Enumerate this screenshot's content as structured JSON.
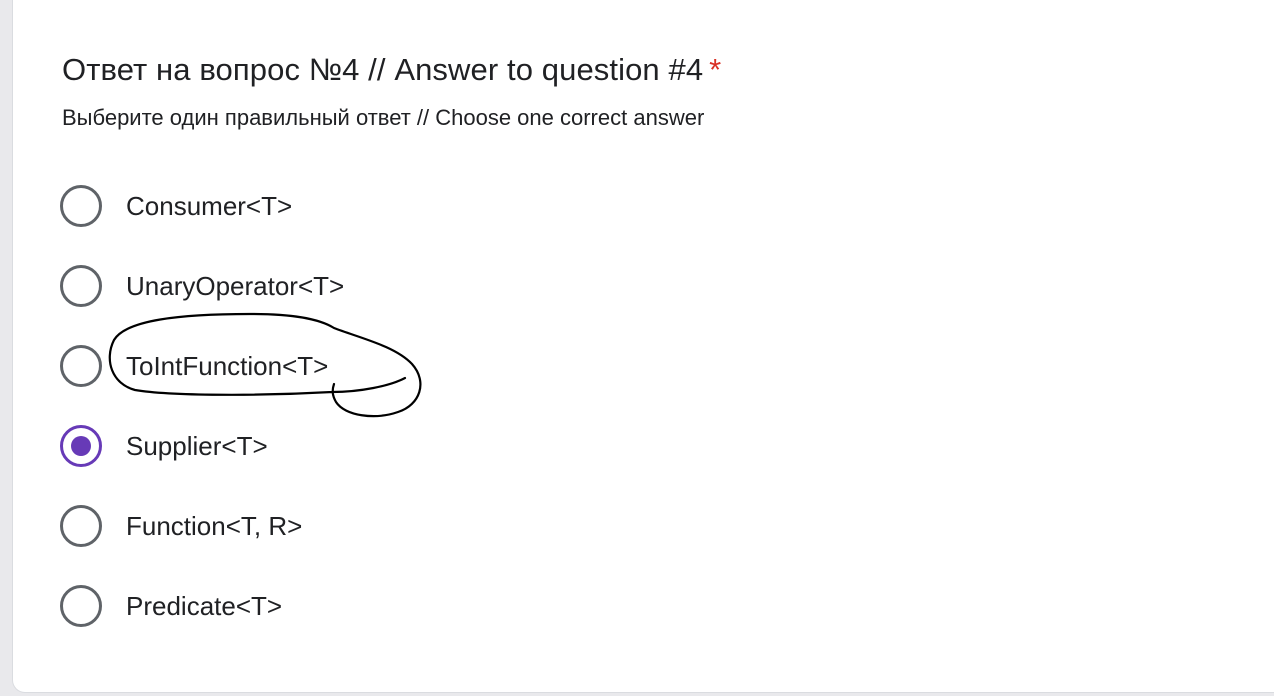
{
  "question": {
    "title": "Ответ на вопрос №4 // Answer to question #4",
    "required_mark": "*",
    "description": "Выберите один правильный ответ // Choose one correct answer"
  },
  "options": [
    {
      "label": "Consumer<T>",
      "selected": false
    },
    {
      "label": "UnaryOperator<T>",
      "selected": false
    },
    {
      "label": "ToIntFunction<T>",
      "selected": false
    },
    {
      "label": "Supplier<T>",
      "selected": true
    },
    {
      "label": "Function<T, R>",
      "selected": false
    },
    {
      "label": "Predicate<T>",
      "selected": false
    }
  ],
  "colors": {
    "accent": "#673ab7",
    "required": "#d93025",
    "radio_border": "#5f6368",
    "annotation_ink": "#000000"
  }
}
